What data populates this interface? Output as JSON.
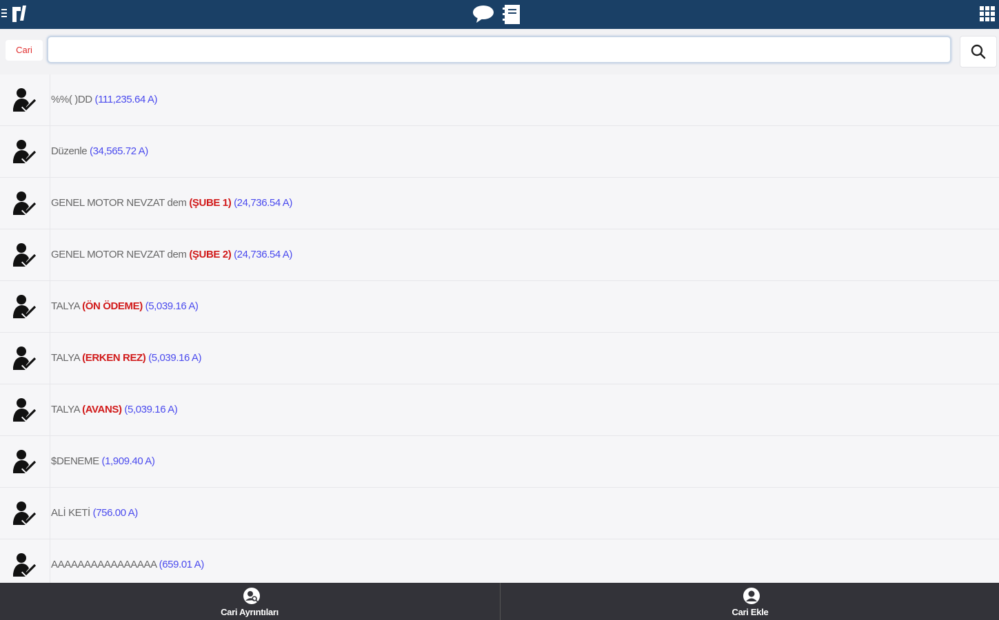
{
  "search": {
    "label": "Cari",
    "value": "",
    "placeholder": ""
  },
  "accounts": [
    {
      "name": "%%( )DD",
      "branch": "",
      "amount": "(111,235.64 A)"
    },
    {
      "name": "Düzenle",
      "branch": "",
      "amount": "(34,565.72 A)"
    },
    {
      "name": "GENEL MOTOR NEVZAT dem",
      "branch": "(ŞUBE 1)",
      "amount": "(24,736.54 A)"
    },
    {
      "name": "GENEL MOTOR NEVZAT dem",
      "branch": "(ŞUBE 2)",
      "amount": "(24,736.54 A)"
    },
    {
      "name": "TALYA",
      "branch": "(ÖN ÖDEME)",
      "amount": "(5,039.16 A)"
    },
    {
      "name": "TALYA",
      "branch": "(ERKEN REZ)",
      "amount": "(5,039.16 A)"
    },
    {
      "name": "TALYA",
      "branch": "(AVANS)",
      "amount": "(5,039.16 A)"
    },
    {
      "name": "$DENEME",
      "branch": "",
      "amount": "(1,909.40 A)"
    },
    {
      "name": "ALİ KETİ",
      "branch": "",
      "amount": "(756.00 A)"
    },
    {
      "name": "AAAAAAAAAAAAAAAA",
      "branch": "",
      "amount": "(659.01 A)"
    }
  ],
  "bottom_tabs": [
    {
      "label": "Cari Ayrıntıları",
      "icon": "search-user-icon"
    },
    {
      "label": "Cari Ekle",
      "icon": "add-user-icon"
    }
  ],
  "colors": {
    "topbar": "#1a4066",
    "bottombar": "#333339",
    "branch": "#d11a1a",
    "amount": "#4a4aee"
  }
}
